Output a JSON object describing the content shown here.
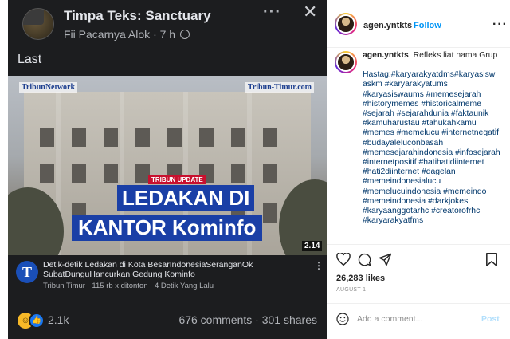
{
  "fb_post": {
    "group_name": "Timpa Teks: Sanctuary",
    "author": "Fii Pacarnya Alok",
    "time": "7 h",
    "separator": "·",
    "caption": "Last",
    "video": {
      "logo_left": "TribunNetwork",
      "logo_right": "Tribun-Timur.com",
      "tag": "TRIBUN UPDATE",
      "headline_1": "LEDAKAN DI",
      "headline_2": "KANTOR Kominfo",
      "duration": "2.14",
      "title": "Detik-detik Ledakan di Kota BesarIndonesiaSeranganOk SubatDunguHancurkan Gedung Kominfo",
      "channel": "Tribun Timur",
      "views": "115 rb x ditonton",
      "ago": "4 Detik Yang Lalu",
      "channel_initial": "T"
    },
    "reactions_count": "2.1k",
    "comments": "676 comments",
    "shares": "301 shares",
    "stats_sep": "·"
  },
  "ig": {
    "username": "agen.yntkts",
    "follow_label": "Follow",
    "dot": "·",
    "caption_text": "Refleks liat nama Grup",
    "hashtags": "Hastag:#karyarakyatdms#karyasisw askm #karyarakyatums #karyasiswaums #memesejarah #historymemes #historicalmeme #sejarah #sejarahdunia #faktaunik #kamuharustau #tahukahkamu #memes #memelucu #internetnegatif #budayaleluconbasah #memesejarahindonesia #infosejarah #internetpositif #hatihatidiinternet #hati2diinternet #dagelan #memeindonesialucu #memelucuindonesia #memeindo #memeindonesia #darkjokes #karyaanggotarhc #creatorofrhc #karyarakyatfms",
    "likes": "26,283 likes",
    "date": "AUGUST 1",
    "comment_placeholder": "Add a comment...",
    "post_label": "Post",
    "icons": [
      "heart-icon",
      "comment-icon",
      "share-icon",
      "bookmark-icon",
      "emoji-icon"
    ]
  }
}
